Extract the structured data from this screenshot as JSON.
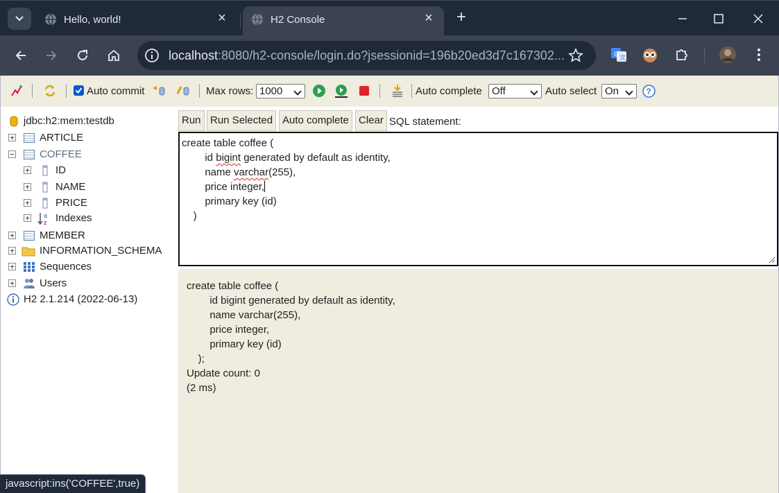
{
  "browser": {
    "tabs": [
      {
        "title": "Hello, world!",
        "active": false
      },
      {
        "title": "H2 Console",
        "active": true
      }
    ],
    "url_host": "localhost",
    "url_rest": ":8080/h2-console/login.do?jsessionid=196b20ed3d7c167302..."
  },
  "h2_toolbar": {
    "auto_commit_label": "Auto commit",
    "auto_commit_checked": true,
    "max_rows_label": "Max rows:",
    "max_rows_value": "1000",
    "auto_complete_label": "Auto complete",
    "auto_complete_value": "Off",
    "auto_select_label": "Auto select",
    "auto_select_value": "On"
  },
  "tree": {
    "connection": "jdbc:h2:mem:testdb",
    "tables": [
      "ARTICLE",
      "COFFEE",
      "MEMBER"
    ],
    "coffee_columns": [
      "ID",
      "NAME",
      "PRICE"
    ],
    "indexes_label": "Indexes",
    "information_schema": "INFORMATION_SCHEMA",
    "sequences": "Sequences",
    "users": "Users",
    "version": "H2 2.1.214 (2022-06-13)"
  },
  "query": {
    "buttons": {
      "run": "Run",
      "run_selected": "Run Selected",
      "auto_complete": "Auto complete",
      "clear": "Clear"
    },
    "sql_label": "SQL statement:",
    "sql_lines": [
      "create table coffee (",
      "id bigint generated by default as identity,",
      "name varchar(255),",
      "price integer,",
      "primary key (id)",
      ")"
    ]
  },
  "result": {
    "lines": [
      "create table coffee (",
      "        id bigint generated by default as identity,",
      "        name varchar(255),",
      "        price integer,",
      "        primary key (id)",
      "    );",
      "Update count: 0",
      "(2 ms)"
    ]
  },
  "status": "javascript:ins('COFFEE',true)",
  "colors": {
    "chrome_dark": "#1f2938",
    "chrome_tab": "#3b4252",
    "h2_panel": "#efece0",
    "accent": "#0b57d0"
  }
}
